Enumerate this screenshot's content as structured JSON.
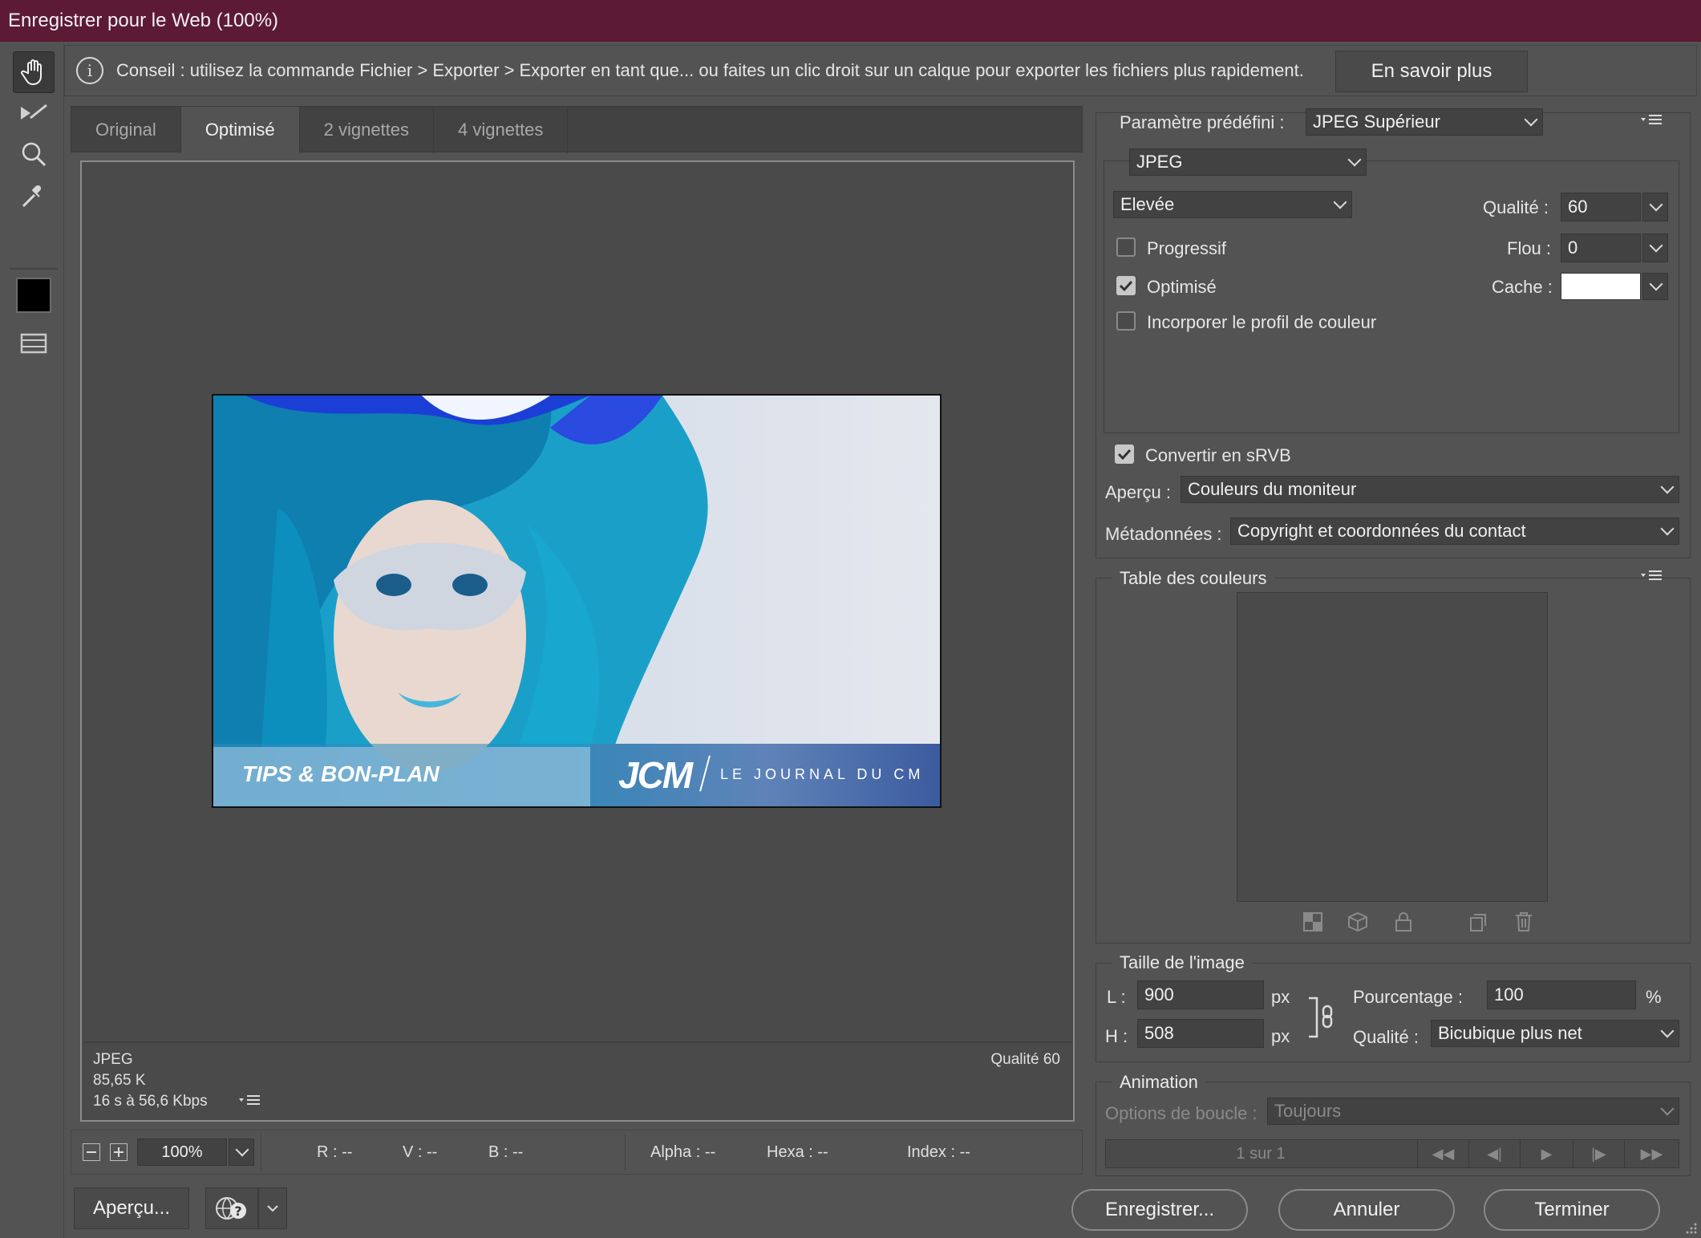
{
  "window": {
    "title": "Enregistrer pour le Web (100%)"
  },
  "tip": {
    "text": "Conseil : utilisez la commande Fichier > Exporter > Exporter en tant que... ou faites un clic droit sur un calque pour exporter les fichiers plus rapidement.",
    "learn_more": "En savoir plus"
  },
  "toolbar": {
    "tools": [
      "hand-icon",
      "slice-select-icon",
      "zoom-icon",
      "eyedropper-icon",
      "eyedropper-color-swatch",
      "toggle-slices-icon"
    ],
    "swatch_color": "#000000"
  },
  "tabs": [
    "Original",
    "Optimisé",
    "2 vignettes",
    "4 vignettes"
  ],
  "active_tab": "Optimisé",
  "preview": {
    "banner_left": "TIPS & BON-PLAN",
    "banner_logo": "JCM",
    "banner_right": "LE JOURNAL DU CM",
    "format": "JPEG",
    "size": "85,65 K",
    "time": "16 s à 56,6 Kbps",
    "quality": "Qualité 60"
  },
  "status": {
    "zoom": "100%",
    "r": "R : --",
    "v": "V : --",
    "b": "B : --",
    "alpha": "Alpha : --",
    "hexa": "Hexa : --",
    "index": "Index : --"
  },
  "settings": {
    "preset_label": "Paramètre prédéfini :",
    "preset_value": "JPEG Supérieur",
    "format_value": "JPEG",
    "compression_value": "Elevée",
    "quality_label": "Qualité :",
    "quality_value": "60",
    "progressive_label": "Progressif",
    "progressive_checked": false,
    "blur_label": "Flou :",
    "blur_value": "0",
    "optimized_label": "Optimisé",
    "optimized_checked": true,
    "matte_label": "Cache :",
    "matte_color": "#ffffff",
    "embed_profile_label": "Incorporer le profil de couleur",
    "embed_profile_checked": false,
    "convert_srgb_label": "Convertir en sRVB",
    "convert_srgb_checked": true,
    "preview_label": "Aperçu :",
    "preview_value": "Couleurs du moniteur",
    "metadata_label": "Métadonnées :",
    "metadata_value": "Copyright et coordonnées du contact"
  },
  "color_table": {
    "title": "Table des couleurs"
  },
  "image_size": {
    "title": "Taille de l'image",
    "w_label": "L :",
    "w_value": "900",
    "w_unit": "px",
    "h_label": "H :",
    "h_value": "508",
    "h_unit": "px",
    "percent_label": "Pourcentage :",
    "percent_value": "100",
    "percent_unit": "%",
    "quality_label": "Qualité :",
    "quality_value": "Bicubique plus net"
  },
  "animation": {
    "title": "Animation",
    "loop_label": "Options de boucle :",
    "loop_value": "Toujours",
    "frame_counter": "1 sur 1"
  },
  "footer": {
    "preview_button": "Aperçu...",
    "save_button": "Enregistrer...",
    "cancel_button": "Annuler",
    "done_button": "Terminer"
  }
}
